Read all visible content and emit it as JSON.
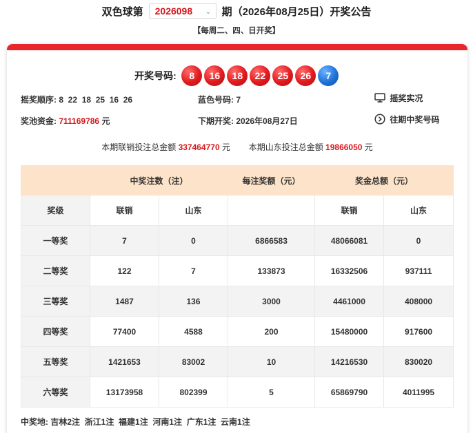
{
  "header": {
    "prefix": "双色球第",
    "issue": "2026098",
    "suffix": "期（2026年08月25日）开奖公告",
    "schedule": "【每周二、四、日开奖】"
  },
  "draw": {
    "label": "开奖号码:",
    "red_balls": [
      "8",
      "16",
      "18",
      "22",
      "25",
      "26"
    ],
    "blue_ball": "7",
    "order_label": "摇奖顺序:",
    "order_value": "8  22  18  25  16  26",
    "blue_label": "蓝色号码:",
    "blue_value": "7",
    "live_link": "摇奖实况",
    "pool_label": "奖池资金:",
    "pool_value": "711169786",
    "pool_unit": "元",
    "next_label": "下期开奖:",
    "next_value": "2026年08月27日",
    "history_link": "往期中奖号码"
  },
  "summary": {
    "total_label": "本期联销投注总金额",
    "total_value": "337464770",
    "total_unit": "元",
    "sd_label": "本期山东投注总金额",
    "sd_value": "19866050",
    "sd_unit": "元"
  },
  "table": {
    "header_count": "中奖注数（注）",
    "header_per": "每注奖额（元）",
    "header_total": "奖金总额（元）",
    "col_grade": "奖级",
    "col_lianxiao": "联销",
    "col_shandong": "山东",
    "rows": [
      {
        "grade": "一等奖",
        "lx": "7",
        "sd": "0",
        "per": "6866583",
        "tlx": "48066081",
        "tsd": "0"
      },
      {
        "grade": "二等奖",
        "lx": "122",
        "sd": "7",
        "per": "133873",
        "tlx": "16332506",
        "tsd": "937111"
      },
      {
        "grade": "三等奖",
        "lx": "1487",
        "sd": "136",
        "per": "3000",
        "tlx": "4461000",
        "tsd": "408000"
      },
      {
        "grade": "四等奖",
        "lx": "77400",
        "sd": "4588",
        "per": "200",
        "tlx": "15480000",
        "tsd": "917600"
      },
      {
        "grade": "五等奖",
        "lx": "1421653",
        "sd": "83002",
        "per": "10",
        "tlx": "14216530",
        "tsd": "830020"
      },
      {
        "grade": "六等奖",
        "lx": "13173958",
        "sd": "802399",
        "per": "5",
        "tlx": "65869790",
        "tsd": "4011995"
      }
    ]
  },
  "winners": {
    "label": "中奖地:",
    "value": "吉林2注  浙江1注  福建1注  河南1注  广东1注  云南1注"
  },
  "colors": {
    "accent_red": "#e8262b",
    "number_red": "#d8171d",
    "blue_ball": "#1f72d8",
    "table_header_bg": "#fde3c9"
  },
  "icons": [
    "monitor-icon",
    "arrow-circle-right-icon",
    "chevron-down-icon"
  ]
}
